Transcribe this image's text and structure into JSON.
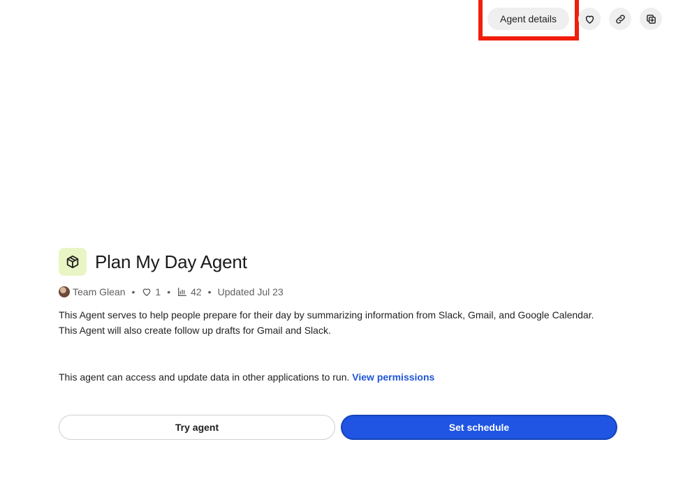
{
  "header": {
    "agent_details_label": "Agent details",
    "icons": [
      "heart-icon",
      "link-icon",
      "duplicate-icon"
    ]
  },
  "agent": {
    "icon": "package-icon",
    "icon_bg": "#e9f5c4",
    "title": "Plan My Day Agent",
    "author": "Team Glean",
    "likes": "1",
    "views": "42",
    "updated": "Updated Jul 23",
    "description_line1": "This Agent serves to help people prepare for their day by summarizing information from Slack, Gmail, and Google Calendar.",
    "description_line2": "This Agent will also create follow up drafts for Gmail and Slack."
  },
  "permissions": {
    "text": "This agent can access and update data in other applications to run.",
    "link_label": "View permissions"
  },
  "actions": {
    "try_label": "Try agent",
    "schedule_label": "Set schedule"
  },
  "colors": {
    "highlight": "#f01e0a",
    "primary": "#1f55e2",
    "link": "#1f55d8"
  }
}
